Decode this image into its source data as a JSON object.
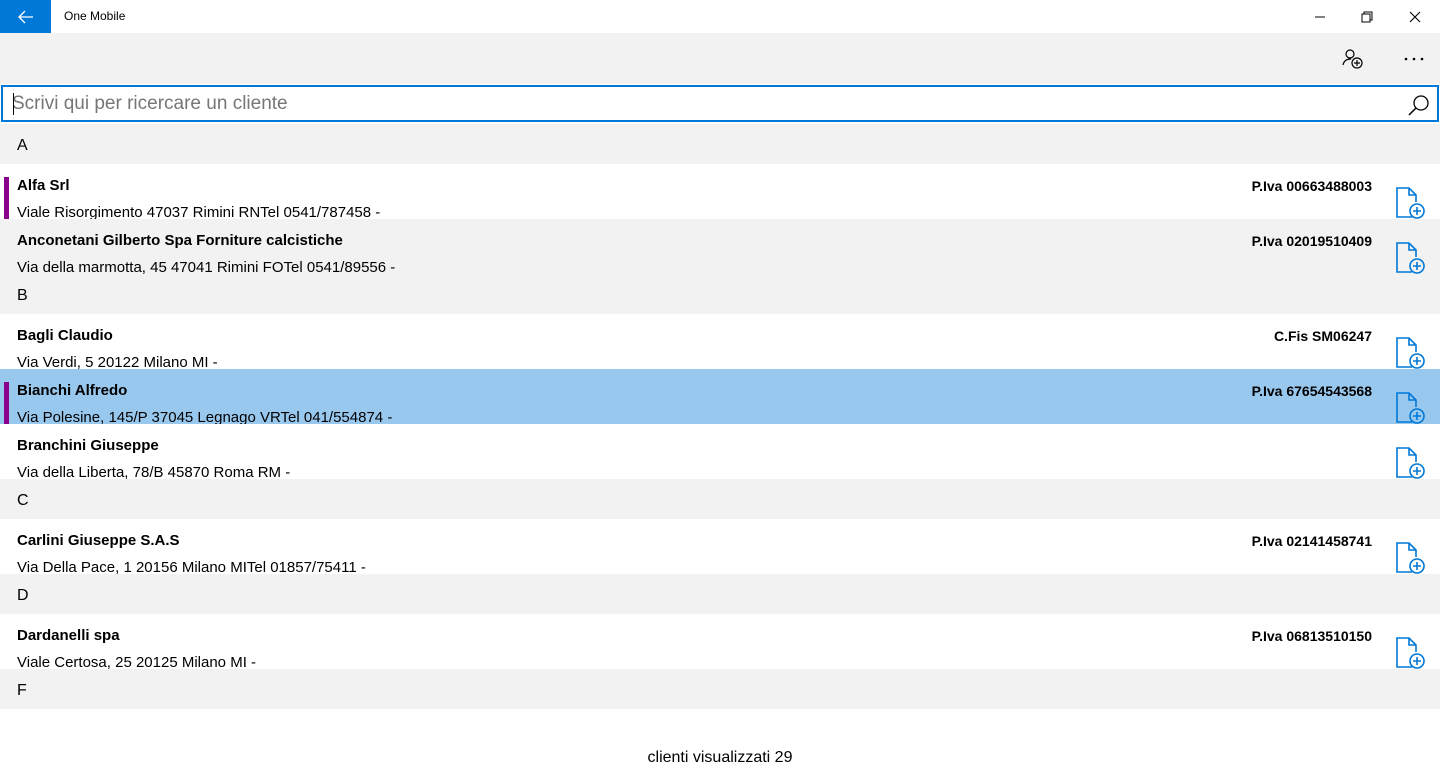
{
  "window": {
    "title": "One Mobile"
  },
  "search": {
    "placeholder": "Scrivi qui per ricercare un cliente",
    "value": ""
  },
  "sections": [
    {
      "letter": "A",
      "clients": [
        {
          "name": "Alfa Srl",
          "address": "Viale Risorgimento 47037 Rimini RNTel 0541/787458  -",
          "fiscal": "P.Iva 00663488003",
          "marked": true,
          "selected": false,
          "alt": false
        },
        {
          "name": "Anconetani Gilberto Spa Forniture calcistiche",
          "address": "Via della marmotta, 45 47041 Rimini FOTel 0541/89556  -",
          "fiscal": "P.Iva 02019510409",
          "marked": false,
          "selected": false,
          "alt": true
        }
      ]
    },
    {
      "letter": "B",
      "clients": [
        {
          "name": "Bagli Claudio",
          "address": "Via Verdi, 5 20122 Milano MI -",
          "fiscal": "C.Fis SM06247",
          "marked": false,
          "selected": false,
          "alt": false
        },
        {
          "name": "Bianchi Alfredo",
          "address": "Via Polesine, 145/P 37045 Legnago VRTel 041/554874  -",
          "fiscal": "P.Iva 67654543568",
          "marked": true,
          "selected": true,
          "alt": false
        },
        {
          "name": "Branchini Giuseppe",
          "address": "Via della Liberta, 78/B 45870 Roma RM -",
          "fiscal": "",
          "marked": false,
          "selected": false,
          "alt": false
        }
      ]
    },
    {
      "letter": "C",
      "clients": [
        {
          "name": "Carlini Giuseppe S.A.S",
          "address": "Via Della Pace, 1 20156 Milano MITel 01857/75411  -",
          "fiscal": "P.Iva 02141458741",
          "marked": false,
          "selected": false,
          "alt": false
        }
      ]
    },
    {
      "letter": "D",
      "clients": [
        {
          "name": "Dardanelli spa",
          "address": "Viale Certosa, 25 20125 Milano MI -",
          "fiscal": "P.Iva 06813510150",
          "marked": false,
          "selected": false,
          "alt": false
        }
      ]
    },
    {
      "letter": "F",
      "clients": []
    }
  ],
  "footer": {
    "count_text": "clienti visualizzati 29"
  },
  "icons": {
    "back": "arrow-left-icon",
    "minimize": "minimize-icon",
    "restore": "restore-icon",
    "close": "close-icon",
    "add_contact": "add-contact-icon",
    "more": "more-icon",
    "search": "search-icon",
    "add_document": "add-document-icon"
  },
  "colors": {
    "accent": "#0078d7",
    "selected_row": "#99c8ef",
    "marker": "#8b008b",
    "section_bg": "#f2f2f2"
  }
}
